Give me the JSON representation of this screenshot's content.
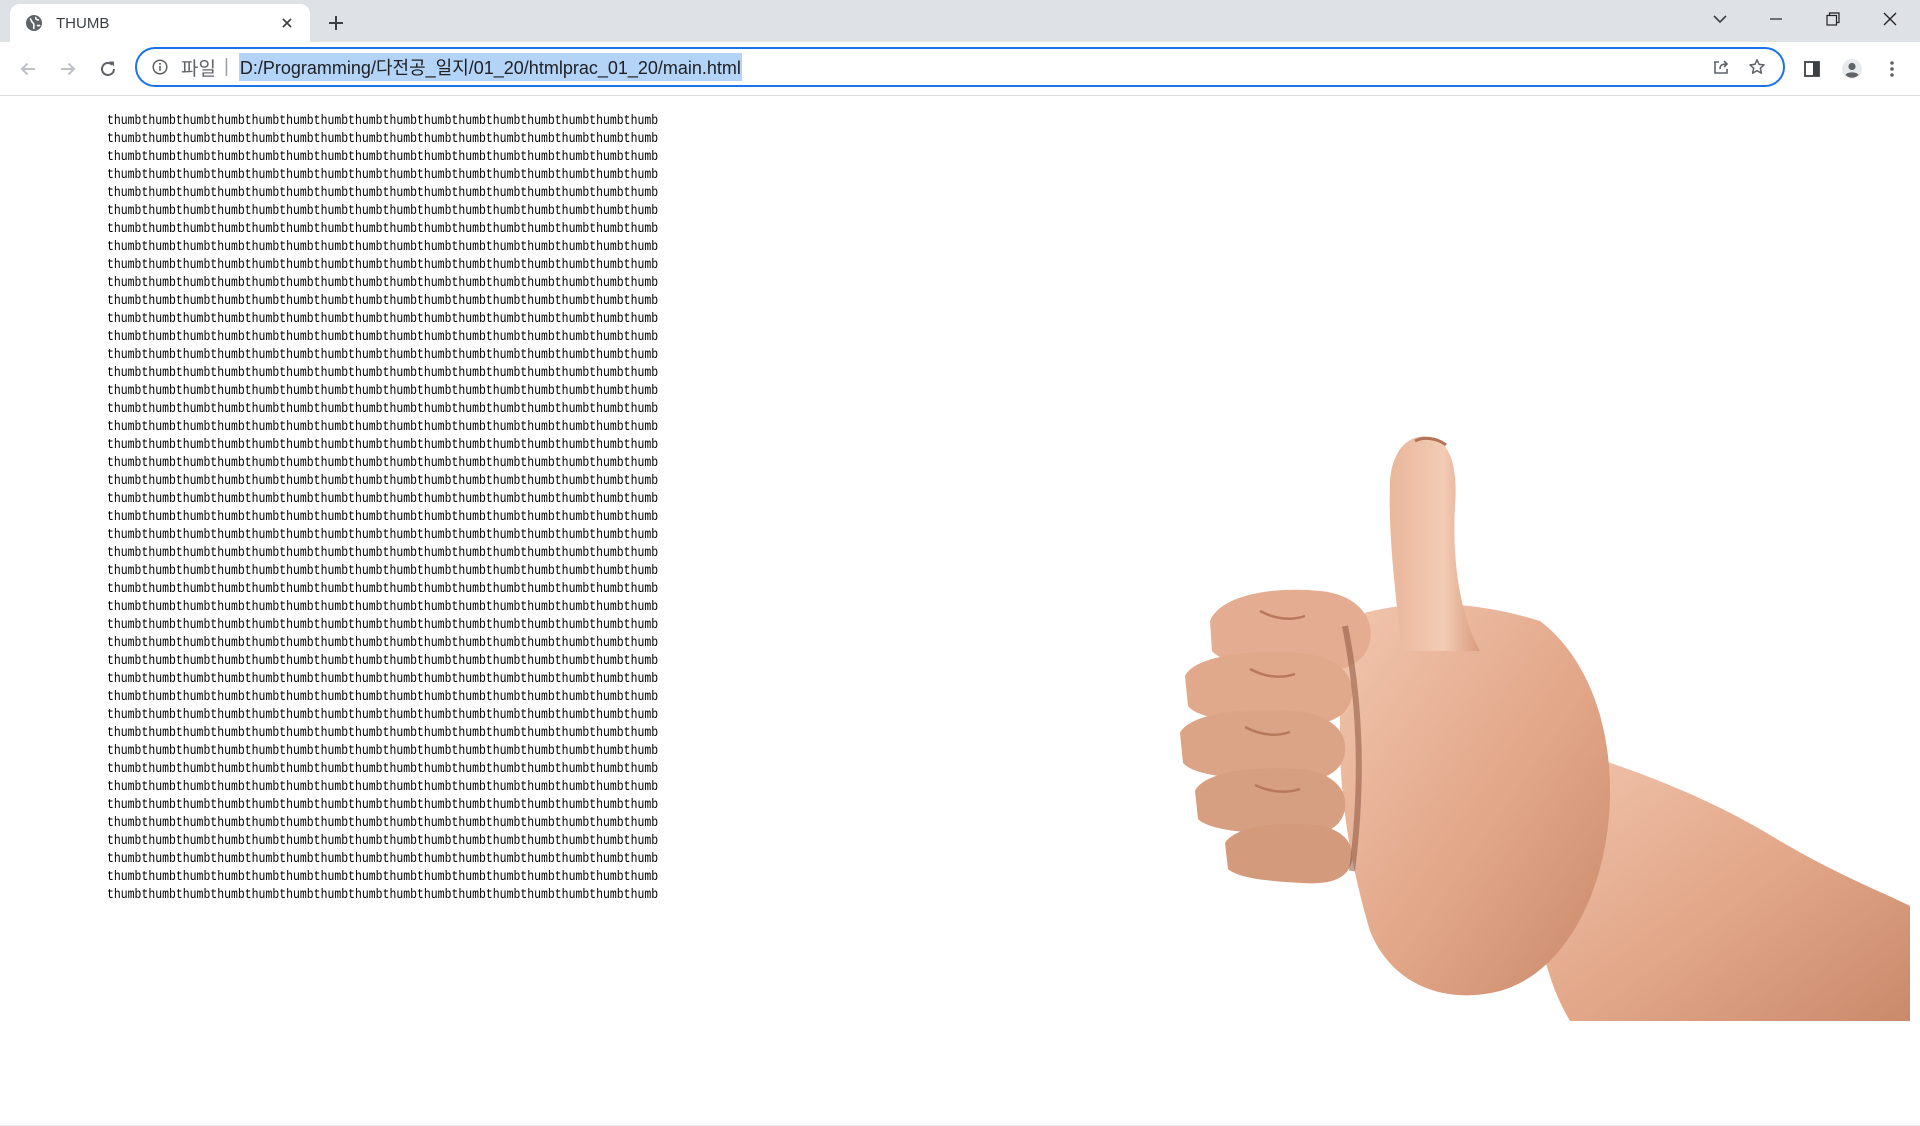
{
  "browser": {
    "tab": {
      "title": "THUMB",
      "favicon": "globe-icon"
    },
    "address": {
      "scheme_label": "파일",
      "url": "D:/Programming/다전공_일지/01_20/htmlprac_01_20/main.html"
    },
    "colors": {
      "accent": "#1a73e8",
      "tabstrip": "#dee1e6",
      "selection": "#b3d3f7"
    }
  },
  "page": {
    "repeat_word": "thumb",
    "repeats_per_line": 16,
    "line_count": 44,
    "image_alt": "thumbs-up hand"
  }
}
